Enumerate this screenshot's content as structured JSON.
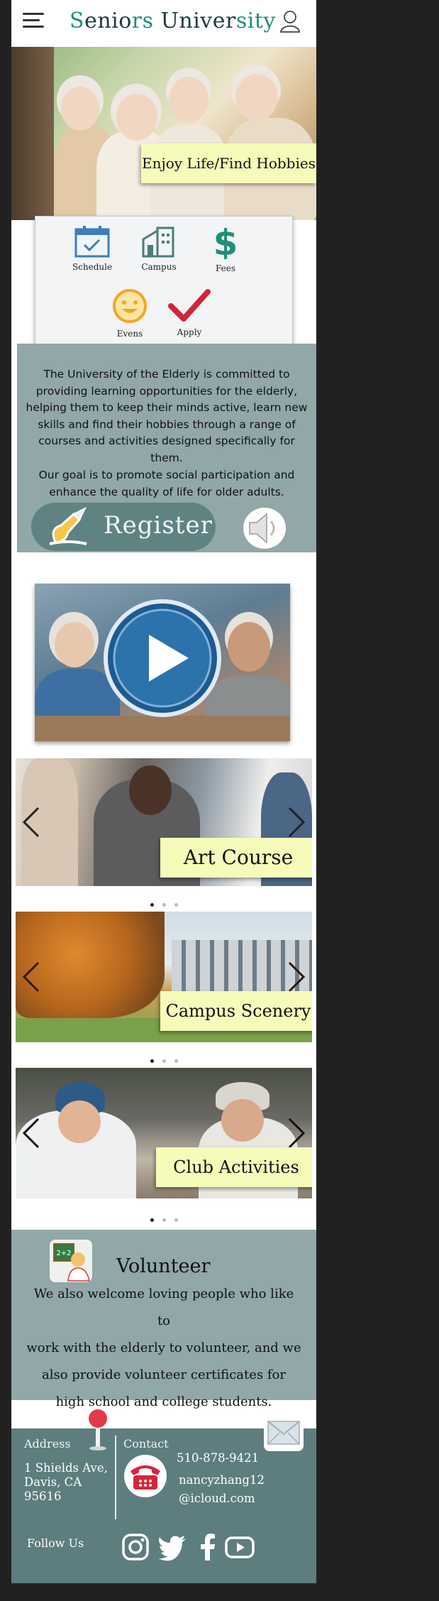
{
  "header": {
    "menu_icon": "hamburger-menu-icon",
    "logo_parts": [
      "S",
      "enio",
      "rs",
      " Univer",
      "sity"
    ],
    "user_icon": "user-profile-icon"
  },
  "hero": {
    "banner": "Enjoy Life/Find Hobbies"
  },
  "quick_links": [
    {
      "label": "Schedule",
      "icon": "calendar-check-icon"
    },
    {
      "label": "Campus",
      "icon": "building-icon"
    },
    {
      "label": "Fees",
      "icon": "dollar-icon"
    },
    {
      "label": "Evens",
      "icon": "smiley-icon"
    },
    {
      "label": "Apply",
      "icon": "checkmark-icon"
    }
  ],
  "about": {
    "paragraph1": "The University of the Elderly is committed to providing learning opportunities for the elderly, helping them to keep their minds active, learn new skills and find their hobbies through a range of courses and activities designed specifically for them.",
    "paragraph2": "Our goal is to promote social participation and enhance the quality of life for older adults.",
    "register_label": "Register",
    "speaker_icon": "speaker-icon"
  },
  "video": {
    "play_icon": "play-button-icon"
  },
  "carousels": [
    {
      "banner": "Art Course",
      "active_dot": 0,
      "dot_count": 3
    },
    {
      "banner": "Campus Scenery",
      "active_dot": 0,
      "dot_count": 3
    },
    {
      "banner": "Club Activities",
      "active_dot": 0,
      "dot_count": 3
    }
  ],
  "volunteer": {
    "title": "Volunteer",
    "lines": [
      "We also welcome loving people who like to",
      "work with the elderly to volunteer, and we",
      "also provide volunteer certificates for",
      "high school and college students."
    ]
  },
  "footer": {
    "address_label": "Address",
    "address_lines": [
      "1 Shields Ave,",
      "Davis, CA",
      "95616"
    ],
    "contact_label": "Contact",
    "phone": "510-878-9421",
    "email_lines": [
      "nancyzhang12",
      "@icloud.com"
    ],
    "follow_label": "Follow Us",
    "social_icons": [
      "instagram-icon",
      "twitter-icon",
      "facebook-icon",
      "youtube-icon"
    ]
  },
  "colors": {
    "logo_green": "#1f8f78",
    "banner_yellow": "#f6fbb9",
    "section_teal": "#91a7a8",
    "footer_teal": "#5d7d7e",
    "register_teal": "#5f8383"
  }
}
